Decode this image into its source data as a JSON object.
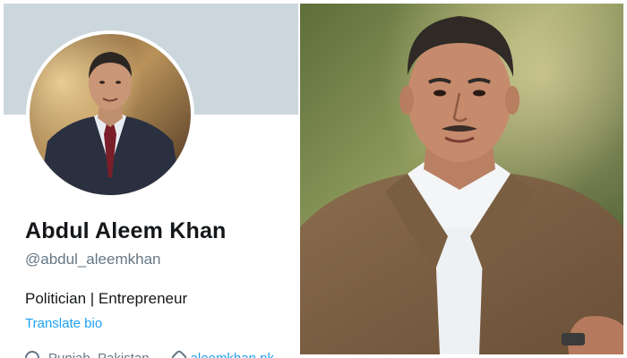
{
  "profile": {
    "name": "Abdul Aleem Khan",
    "handle": "@abdul_aleemkhan",
    "bio": "Politician | Entrepreneur",
    "translate_label": "Translate bio",
    "meta_location": "Punjab, Pakistan",
    "meta_link": "aleemkhan.pk"
  },
  "colors": {
    "banner": "#ccd6dd",
    "link": "#1da1f2",
    "text_primary": "#14171a",
    "text_secondary": "#657786"
  },
  "icons": {
    "location": "location-pin-icon",
    "link": "link-icon"
  }
}
